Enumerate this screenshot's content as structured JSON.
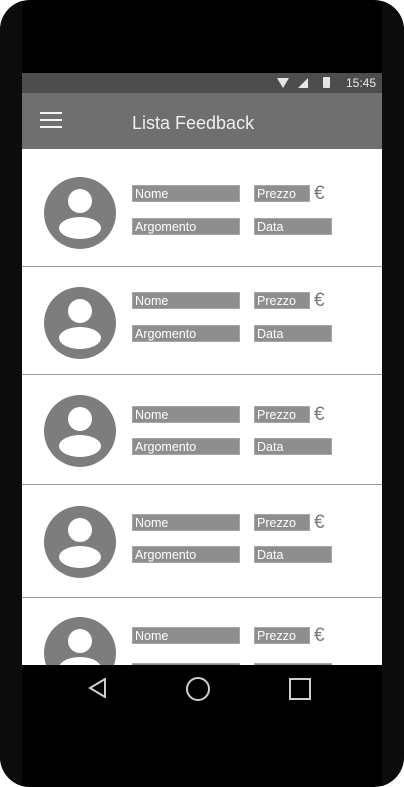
{
  "status_bar": {
    "time": "15:45",
    "icons": [
      "wifi-icon",
      "signal-icon",
      "battery-icon"
    ]
  },
  "app_bar": {
    "title": "Lista Feedback",
    "menu_icon": "hamburger-menu-icon"
  },
  "feedback_items": [
    {
      "name": "Nome",
      "price": "Prezzo",
      "currency": "€",
      "topic": "Argomento",
      "date": "Data"
    },
    {
      "name": "Nome",
      "price": "Prezzo",
      "currency": "€",
      "topic": "Argomento",
      "date": "Data"
    },
    {
      "name": "Nome",
      "price": "Prezzo",
      "currency": "€",
      "topic": "Argomento",
      "date": "Data"
    },
    {
      "name": "Nome",
      "price": "Prezzo",
      "currency": "€",
      "topic": "Argomento",
      "date": "Data"
    },
    {
      "name": "Nome",
      "price": "Prezzo",
      "currency": "€",
      "topic": "",
      "date": ""
    }
  ],
  "nav_bar": {
    "icons": [
      "back-icon",
      "home-icon",
      "recent-apps-icon"
    ]
  },
  "colors": {
    "app_bar": "#6f6f6f",
    "status_bar": "#4d4d4d",
    "field": "#8e8e8e",
    "avatar": "#7d7d7d"
  }
}
